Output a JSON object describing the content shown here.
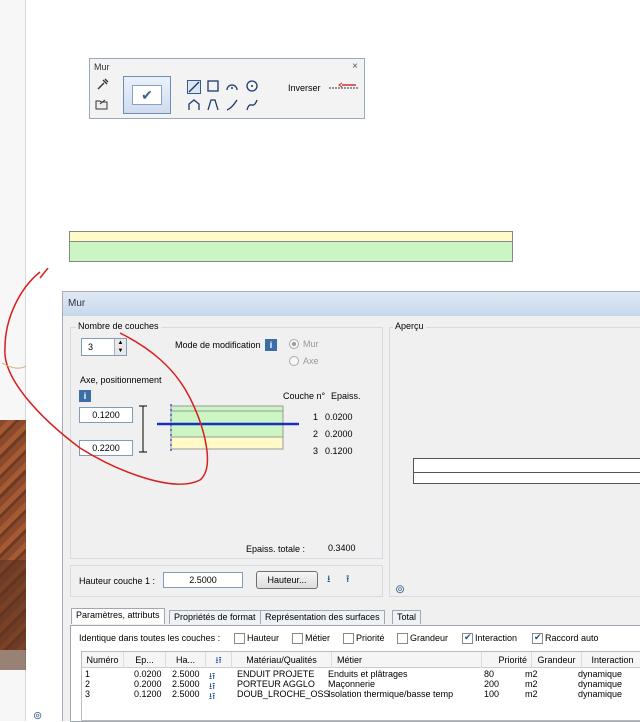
{
  "toolbar": {
    "title": "Mur",
    "close_glyph": "×",
    "inverser_label": "Inverser",
    "icons": [
      "eyedropper-icon",
      "open-folder-icon",
      "check-icon",
      "line-icon",
      "rectangle-icon",
      "arc-icon",
      "circle-icon",
      "polyline-icon",
      "trapezoid-icon",
      "curve-icon",
      "spline-icon",
      "inverse-icon"
    ]
  },
  "dialog": {
    "title": "Mur",
    "nombre_couches_label": "Nombre de couches",
    "nombre_couches_value": "3",
    "mode_modification_label": "Mode de modification",
    "radio_mur": "Mur",
    "radio_axe": "Axe",
    "apercu_label": "Aperçu",
    "axe_positionnement_label": "Axe, positionnement",
    "axe_top_value": "0.1200",
    "axe_bottom_value": "0.2200",
    "couche_header": "Couche n°",
    "epaiss_header": "Epaiss.",
    "couches": [
      {
        "n": "1",
        "ep": "0.0200"
      },
      {
        "n": "2",
        "ep": "0.2000"
      },
      {
        "n": "3",
        "ep": "0.1200"
      }
    ],
    "epaiss_totale_label": "Epaiss. totale :",
    "epaiss_totale_value": "0.3400",
    "hauteur_couche_label": "Hauteur couche 1 :",
    "hauteur_couche_value": "2.5000",
    "hauteur_button": "Hauteur...",
    "tabs": [
      "Paramètres, attributs",
      "Propriétés de format",
      "Représentation des surfaces",
      "Total"
    ],
    "identique_label": "Identique dans toutes les couches :",
    "checks": [
      {
        "label": "Hauteur",
        "checked": false
      },
      {
        "label": "Métier",
        "checked": false
      },
      {
        "label": "Priorité",
        "checked": false
      },
      {
        "label": "Grandeur",
        "checked": false
      },
      {
        "label": "Interaction",
        "checked": true
      },
      {
        "label": "Raccord auto",
        "checked": true
      }
    ],
    "columns": [
      "Numéro",
      "Ep...",
      "Ha...",
      "",
      "Matériau/Qualités",
      "Métier",
      "Priorité",
      "Grandeur",
      "Interaction"
    ],
    "rows": [
      {
        "num": "1",
        "ep": "0.0200",
        "ha": "2.5000",
        "mat": "ENDUIT PROJETE",
        "metier": "Enduits et plâtrages",
        "prio": "80",
        "gr": "m2",
        "inter": "dynamique"
      },
      {
        "num": "2",
        "ep": "0.2000",
        "ha": "2.5000",
        "mat": "PORTEUR AGGLO",
        "metier": "Maçonnerie",
        "prio": "200",
        "gr": "m2",
        "inter": "dynamique"
      },
      {
        "num": "3",
        "ep": "0.1200",
        "ha": "2.5000",
        "mat": "DOUB_LROCHE_OSS",
        "metier": "Isolation thermique/basse temp",
        "prio": "100",
        "gr": "m2",
        "inter": "dynamique"
      }
    ]
  },
  "colors": {
    "layer_yellow": "#fffac8",
    "layer_green": "#ccf5c4",
    "axis_blue": "#1a2fbf",
    "annotation_red": "#d81e1e"
  }
}
